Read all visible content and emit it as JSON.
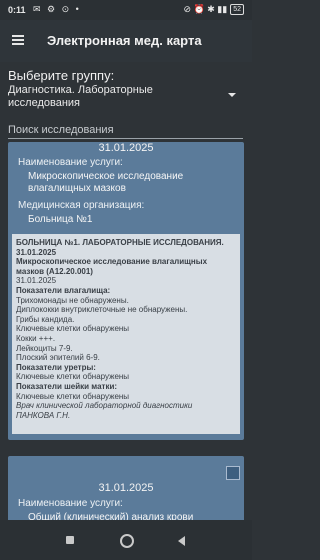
{
  "status": {
    "time": "0:11",
    "battery": "52",
    "left_icons": "✉ ⚙ ⊙ •",
    "right_icons": "⊘ ⏰ ✱ ▮▮"
  },
  "app": {
    "title": "Электронная мед. карта"
  },
  "group": {
    "label": "Выберите группу:",
    "selected": "Диагностика. Лабораторные исследования"
  },
  "search": {
    "placeholder": "Поиск исследования"
  },
  "cards": [
    {
      "date": "31.01.2025",
      "service_label": "Наименование услуги:",
      "service_value": "Микроскопическое исследование влагалищных мазков",
      "org_label": "Медицинская организация:",
      "org_value": "Больница №1",
      "report": {
        "header": "БОЛЬНИЦА №1. ЛАБОРАТОРНЫЕ ИССЛЕДОВАНИЯ.",
        "header_date": "31.01.2025",
        "study_line1": "Микроскопическое исследование влагалищных",
        "study_line2": "мазков (A12.20.001)",
        "study_date": "31.01.2025",
        "section1": "Показатели влагалища:",
        "l1": "Трихомонады не обнаружены.",
        "l2": "Диплококки внутриклеточные не обнаружены.",
        "l3": "Грибы кандида.",
        "l4": "Ключевые клетки обнаружены",
        "l5": "Кокки +++.",
        "l6": "Лейкоциты 7-9.",
        "l7": "Плоский эпителий 6-9.",
        "section2": "Показатели уретры:",
        "l8": "Ключевые клетки обнаружены",
        "section3": "Показатели шейки матки:",
        "l9": "Ключевые клетки обнаружены",
        "doctor": "Врач клинической лабораторной диагностики",
        "doctor_name": "ПАНКОВА Г.Н."
      }
    },
    {
      "date": "31.01.2025",
      "service_label": "Наименование услуги:",
      "service_value": "Общий (клинический) анализ крови"
    }
  ]
}
